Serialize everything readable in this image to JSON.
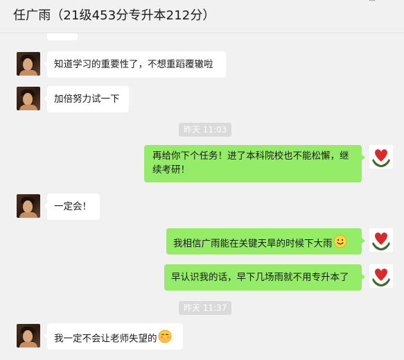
{
  "header": {
    "title": "任广雨（21级453分专升本212分）"
  },
  "messages": [
    {
      "from": "contact",
      "text": "知道学习的重要性了，不想重蹈覆辙啦"
    },
    {
      "from": "contact",
      "text": "加倍努力试一下"
    },
    {
      "from": "me",
      "text": "再给你下个任务！进了本科院校也不能松懈，继续考研！"
    },
    {
      "from": "contact",
      "text": "一定会！"
    },
    {
      "from": "me",
      "text": "我相信广雨能在关键天旱的时候下大雨",
      "emoji": "smile-emoji"
    },
    {
      "from": "me",
      "text": "早认识我的话，早下几场雨就不用专升本了"
    },
    {
      "from": "contact",
      "text": "我一定不会让老师失望的",
      "emoji": "blushing-face-emoji"
    }
  ],
  "timestamps": [
    "昨天 11:03",
    "昨天 11:37"
  ],
  "colors": {
    "background": "#f1f1f1",
    "incoming_bubble": "#ffffff",
    "outgoing_bubble": "#95ec69",
    "timestamp_bg": "#dadada",
    "heart": "#d62b2b"
  },
  "icons": {
    "contact_avatar": "photo-avatar",
    "my_avatar": "heart-hands-avatar"
  }
}
